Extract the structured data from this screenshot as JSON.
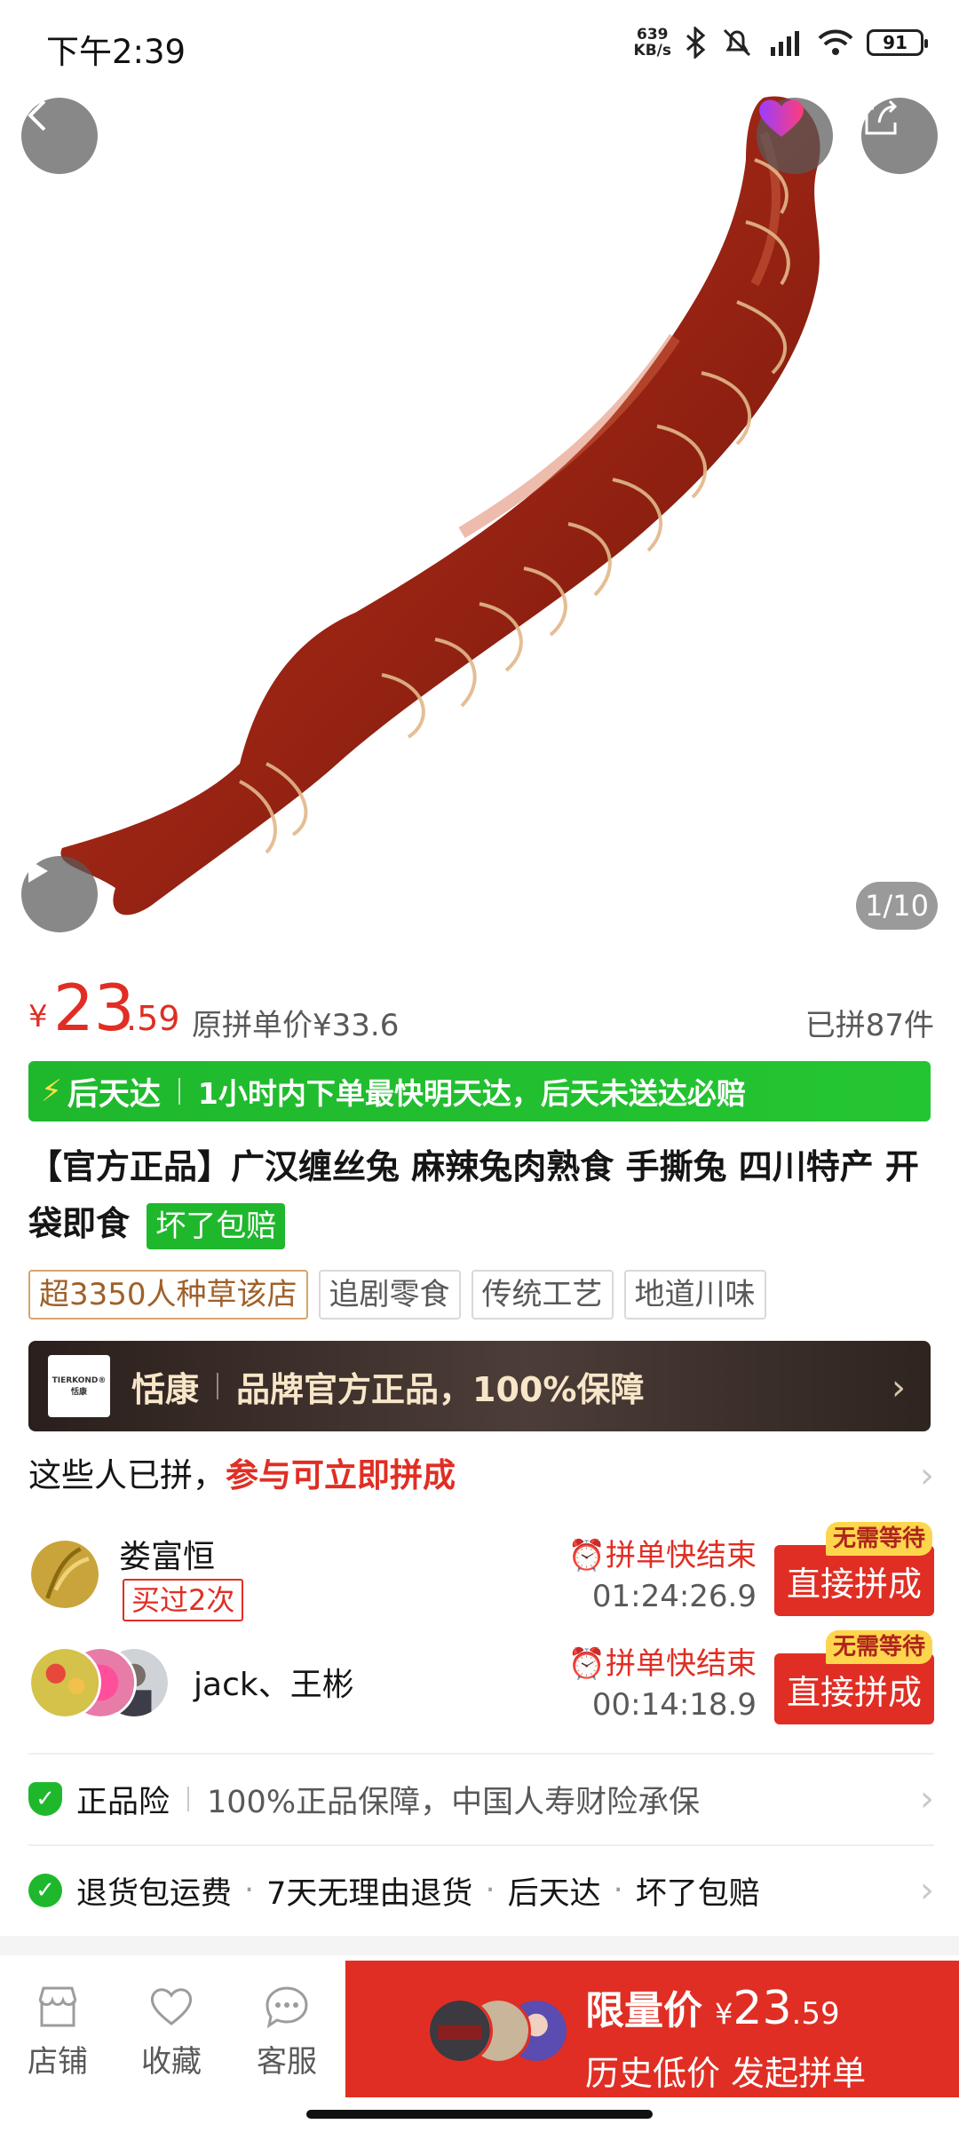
{
  "status_bar": {
    "time": "下午2:39",
    "net_speed_value": "639",
    "net_speed_unit": "KB/s",
    "battery": "91"
  },
  "hero": {
    "image_counter": "1/10",
    "icons": [
      "back-icon",
      "favorite-icon",
      "share-icon",
      "play-icon"
    ]
  },
  "price": {
    "currency": "¥",
    "integer": "23",
    "decimal": ".59",
    "original": "原拼单价¥33.6",
    "sold": "已拼87件"
  },
  "delivery": {
    "name": "后天达",
    "text": "1小时内下单最快明天达，后天未送达必赔"
  },
  "title": {
    "text": "【官方正品】广汉缠丝兔 麻辣兔肉熟食 手撕兔 四川特产 开袋即食",
    "badge": "坏了包赔"
  },
  "tags": [
    "超3350人种草该店",
    "追剧零食",
    "传统工艺",
    "地道川味"
  ],
  "brand": {
    "logo_top": "TIERKOND®",
    "logo_bottom": "恬康",
    "name": "恬康",
    "text": "品牌官方正品，100%保障"
  },
  "group": {
    "header_plain": "这些人已拼，",
    "header_red": "参与可立即拼成",
    "rows": [
      {
        "name": "娄富恒",
        "bought": "买过2次",
        "ending": "拼单快结束",
        "countdown": "01:24:26.9",
        "button": "直接拼成",
        "badge": "无需等待"
      },
      {
        "name": "jack、王彬",
        "ending": "拼单快结束",
        "countdown": "00:14:18.9",
        "button": "直接拼成",
        "badge": "无需等待"
      }
    ]
  },
  "guarantees": {
    "row1_main": "正品险",
    "row1_text": "100%正品保障，中国人寿财险承保",
    "row2_items": [
      "退货包运费",
      "7天无理由退货",
      "后天达",
      "坏了包赔"
    ]
  },
  "bottom": {
    "shop": "店铺",
    "favorite": "收藏",
    "service": "客服",
    "buy_label": "限量价",
    "buy_currency": "¥",
    "buy_int": "23",
    "buy_dec": ".59",
    "buy_sub": "历史低价 发起拼单"
  },
  "colors": {
    "accent": "#e02e24",
    "green": "#1fb82d",
    "brand_bar": "#3a2d29"
  }
}
